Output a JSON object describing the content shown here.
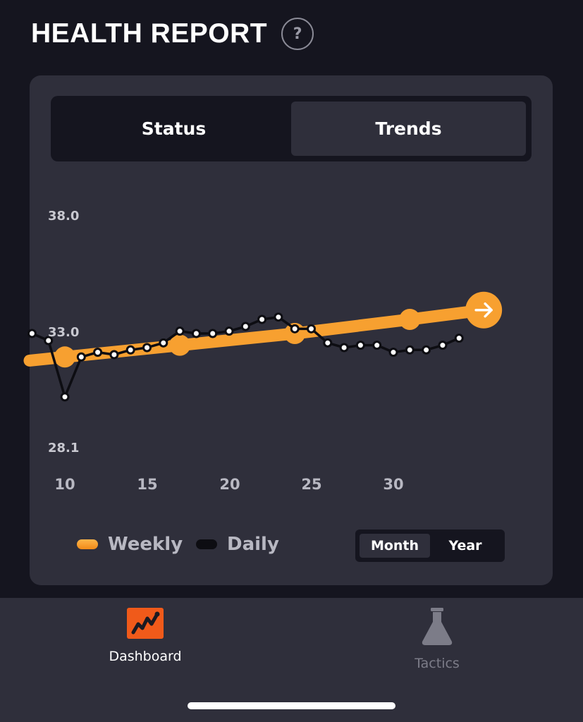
{
  "header": {
    "title": "HEALTH REPORT",
    "help_glyph": "?"
  },
  "tabs": [
    {
      "label": "Status",
      "selected": false
    },
    {
      "label": "Trends",
      "selected": true
    }
  ],
  "chart_data": {
    "type": "line",
    "y_ticks": [
      "38.0",
      "33.0",
      "28.1"
    ],
    "ylim": [
      28.1,
      38.0
    ],
    "x_ticks": [
      "10",
      "15",
      "20",
      "25",
      "30"
    ],
    "series": [
      {
        "name": "Weekly",
        "color": "#f7a030",
        "x": [
          10,
          17,
          24,
          31,
          35.5
        ],
        "y": [
          32.0,
          32.5,
          33.0,
          33.6,
          34.0
        ],
        "end_marker": "arrow-right-icon"
      },
      {
        "name": "Daily",
        "color": "#0d0d12",
        "x": [
          8,
          9,
          10,
          11,
          12,
          13,
          14,
          15,
          16,
          17,
          18,
          19,
          20,
          21,
          22,
          23,
          24,
          25,
          26,
          27,
          28,
          29,
          30,
          31,
          32,
          33,
          34
        ],
        "y": [
          33.0,
          32.7,
          30.3,
          32.0,
          32.2,
          32.1,
          32.3,
          32.4,
          32.6,
          33.1,
          33.0,
          33.0,
          33.1,
          33.3,
          33.6,
          33.7,
          33.2,
          33.2,
          32.6,
          32.4,
          32.5,
          32.5,
          32.2,
          32.3,
          32.3,
          32.5,
          32.8
        ]
      }
    ]
  },
  "legend": [
    {
      "label": "Weekly",
      "color": "#f7a030"
    },
    {
      "label": "Daily",
      "color": "#0d0d12"
    }
  ],
  "range_toggle": {
    "options": [
      "Month",
      "Year"
    ],
    "selected": "Month"
  },
  "bottom_nav": [
    {
      "label": "Dashboard",
      "icon": "trend-chart-icon",
      "active": true,
      "color": "#ffffff"
    },
    {
      "label": "Tactics",
      "icon": "flask-icon",
      "active": false,
      "color": "#7c7c88"
    }
  ],
  "colors": {
    "accent": "#f7a030",
    "dashboard_icon_bg": "#f05a1a",
    "background": "#15151f",
    "card": "#2f2f3b"
  }
}
